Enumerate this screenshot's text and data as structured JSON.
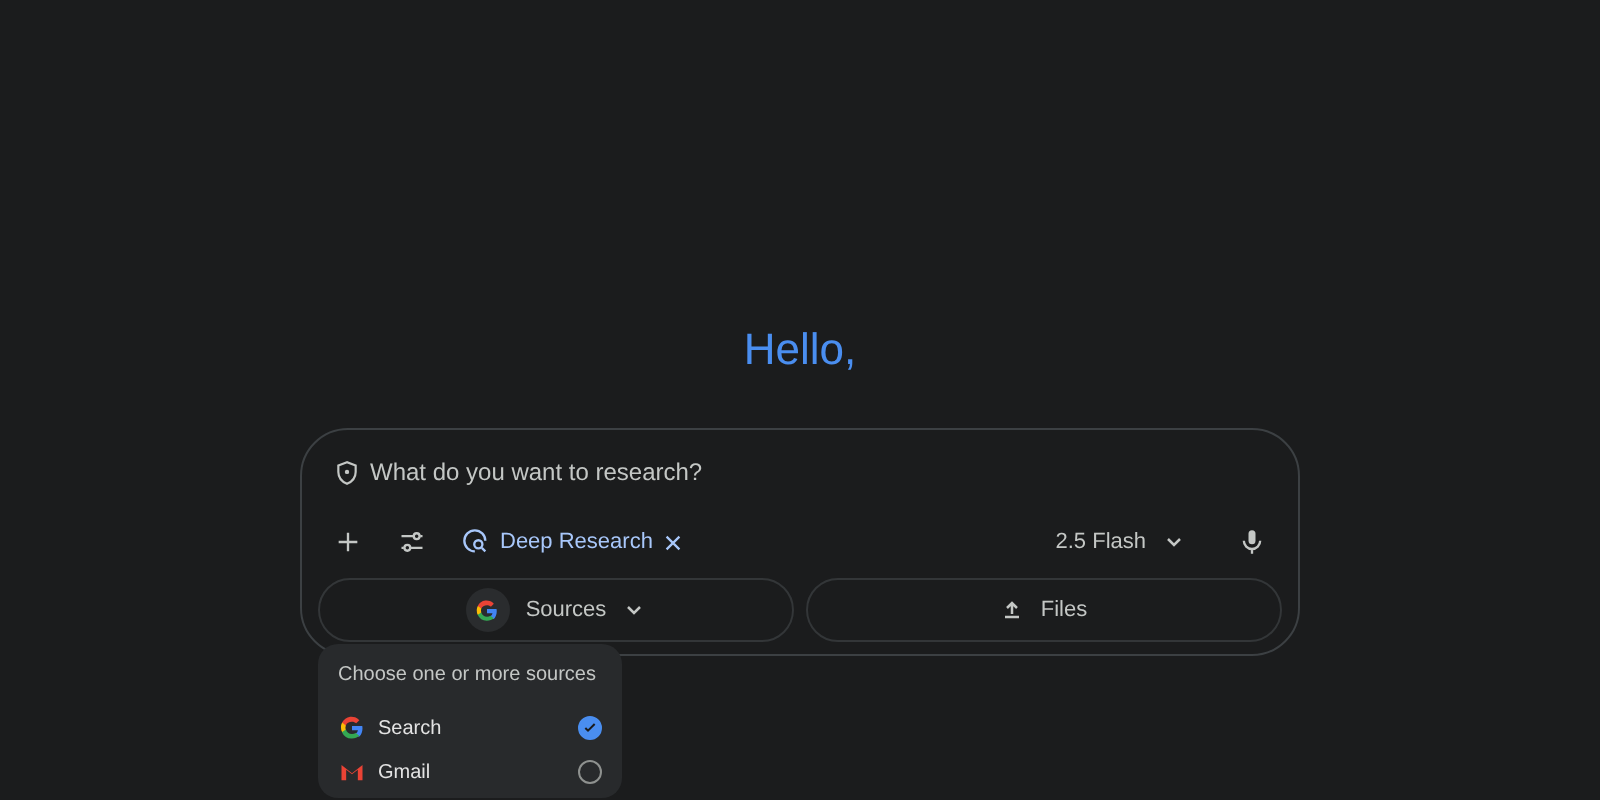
{
  "greeting": "Hello,",
  "prompt": {
    "placeholder": "What do you want to research?"
  },
  "toolbar": {
    "tool_chip": "Deep Research",
    "model": "2.5 Flash"
  },
  "buttons": [
    {
      "label": "Sources",
      "kind": "sources"
    },
    {
      "label": "Files",
      "kind": "files"
    }
  ],
  "sources_menu": {
    "title": "Choose one or more sources",
    "items": [
      {
        "label": "Search",
        "kind": "google",
        "checked": true
      },
      {
        "label": "Gmail",
        "kind": "gmail",
        "checked": false
      }
    ]
  }
}
